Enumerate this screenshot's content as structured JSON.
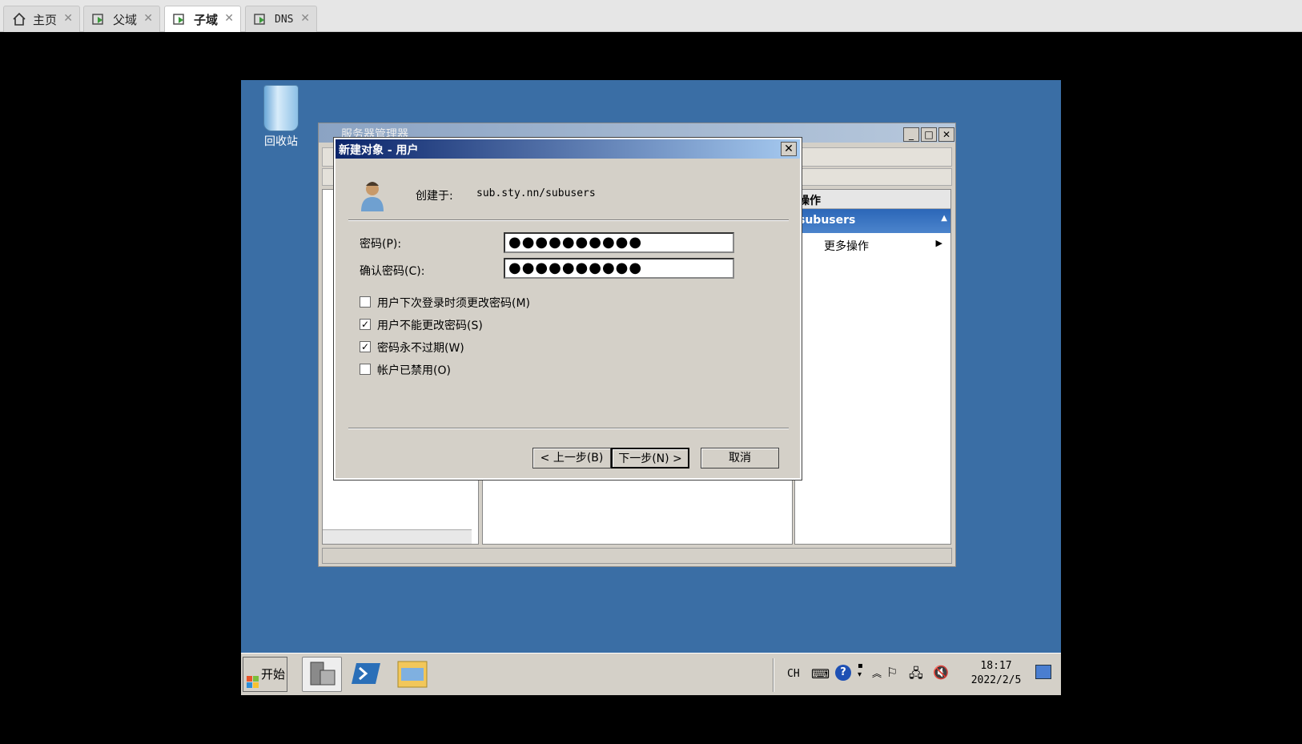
{
  "host_tabs": [
    {
      "label": "主页",
      "icon": "home-icon"
    },
    {
      "label": "父域",
      "icon": "vm-icon"
    },
    {
      "label": "子域",
      "icon": "vm-icon",
      "active": true
    },
    {
      "label": "DNS",
      "icon": "vm-icon"
    }
  ],
  "desktop": {
    "recycle_bin_label": "回收站"
  },
  "server_manager": {
    "title": "服务器管理器",
    "actions_header": "操作",
    "actions_selected": "subusers",
    "actions_more": "更多操作"
  },
  "dialog": {
    "title": "新建对象 - 用户",
    "created_in_label": "创建于:",
    "created_in_value": "sub.sty.nn/subusers",
    "password_label": "密码(P):",
    "password_value": "●●●●●●●●●●",
    "confirm_label": "确认密码(C):",
    "confirm_value": "●●●●●●●●●●",
    "options": [
      {
        "label": "用户下次登录时须更改密码(M)",
        "checked": false
      },
      {
        "label": "用户不能更改密码(S)",
        "checked": true
      },
      {
        "label": "密码永不过期(W)",
        "checked": true
      },
      {
        "label": "帐户已禁用(O)",
        "checked": false
      }
    ],
    "back_label": "< 上一步(B)",
    "next_label": "下一步(N) >",
    "cancel_label": "取消"
  },
  "taskbar": {
    "start_label": "开始",
    "lang": "CH",
    "time": "18:17",
    "date": "2022/2/5"
  },
  "colors": {
    "desktop": "#3a6ea5",
    "title_active": "#0a246a",
    "selection": "#2b66b8"
  }
}
